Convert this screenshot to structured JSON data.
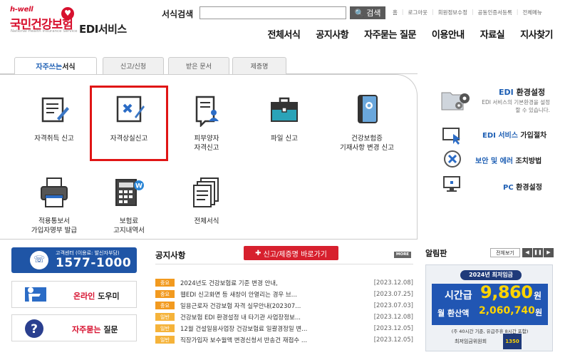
{
  "header": {
    "logo_top": "h-well",
    "logo_main": "국민건강보험",
    "logo_sub": "National Health Insurance Service",
    "logo_service": "EDI서비스",
    "search_label": "서식검색",
    "search_value": "",
    "search_button": "검색",
    "util_links": [
      "홈",
      "로그아웃",
      "회원정보수정",
      "공동인증서등록",
      "전체메뉴"
    ],
    "gnb": [
      "전체서식",
      "공지사항",
      "자주묻는 질문",
      "이용안내",
      "자료실",
      "지사찾기"
    ]
  },
  "tabs": [
    {
      "label_red": "자주쓰는",
      "label": " 서식",
      "active": true
    },
    {
      "label": "신고/신청",
      "active": false
    },
    {
      "label": "받은 문서",
      "active": false
    },
    {
      "label": "제증명",
      "active": false
    }
  ],
  "forms": [
    {
      "line1": "자격취득 신고",
      "line2": "",
      "icon": "pen-document-icon"
    },
    {
      "line1": "자격상실신고",
      "line2": "",
      "icon": "x-document-icon"
    },
    {
      "line1": "피부양자",
      "line2": "자격신고",
      "icon": "person-document-icon"
    },
    {
      "line1": "파일 신고",
      "line2": "",
      "icon": "briefcase-icon"
    },
    {
      "line1": "건강보험증",
      "line2": "기재사항 변경 신고",
      "icon": "card-icon"
    },
    {
      "line1": "적용통보서",
      "line2": "가입자명부 발급",
      "icon": "printer-icon"
    },
    {
      "line1": "보험료",
      "line2": "고지내역서",
      "icon": "calculator-icon"
    },
    {
      "line1": "전체서식",
      "line2": "",
      "icon": "documents-icon"
    }
  ],
  "right_links": [
    {
      "blue": "EDI",
      "rest": " 환경설정",
      "icon": "folder-gear-icon"
    },
    {
      "blue": "EDI 서비스",
      "rest": " 가입절차",
      "icon": "monitor-cursor-icon"
    },
    {
      "blue": "보안 및 에러",
      "rest": " 조치방법",
      "icon": "error-x-icon"
    },
    {
      "blue": "PC",
      "rest": " 환경설정",
      "icon": "pc-icon"
    }
  ],
  "right_desc": "EDI 서비스의 기본환경을 설정 할 수 있습니다.",
  "callcenter": {
    "label": "고객센터 (이용료: 발신자부담)",
    "number": "1577-1000"
  },
  "side_buttons": [
    {
      "red": "온라인",
      "rest": " 도우미",
      "icon": "helper-icon"
    },
    {
      "red": "자주묻는",
      "rest": " 질문",
      "icon": "question-icon"
    }
  ],
  "notice": {
    "title": "공지사항",
    "button": "신고/제증명 바로가기",
    "more": "MORE",
    "items": [
      {
        "badge": "중요",
        "title": "2024년도 건강보험료 기준 변경 안내,",
        "date": "[2023.12.08]"
      },
      {
        "badge": "중요",
        "title": "웹EDI 신고화면 등 새창이 안열리는 경우 브...",
        "date": "[2023.07.25]"
      },
      {
        "badge": "중요",
        "title": "일용근로자 건강보험 자격 실무안내(202307...",
        "date": "[2023.07.03]"
      },
      {
        "badge": "일반",
        "title": "건강보험 EDI 환경설정 내 타기관 사업장정보...",
        "date": "[2023.12.08]"
      },
      {
        "badge": "일반",
        "title": "12월 건설일용사업장 건강보험료 일괄경정일 변...",
        "date": "[2023.12.05]"
      },
      {
        "badge": "일반",
        "title": "직장가입자 보수월액 변경신청서 반송건 재접수 ...",
        "date": "[2023.12.05]"
      }
    ]
  },
  "board": {
    "title": "알림판",
    "all_button": "전체보기",
    "banner_year": "2024년 최저임금",
    "hourly_label": "시간급",
    "hourly_value": "9,860",
    "hourly_unit": "원",
    "monthly_label": "월 환산액",
    "monthly_value": "2,060,740",
    "monthly_unit": "원",
    "note": "(주 40시간 기준, 유급주휴 8시간 포함)",
    "org": "최저임금위원회",
    "phone": "1350"
  }
}
